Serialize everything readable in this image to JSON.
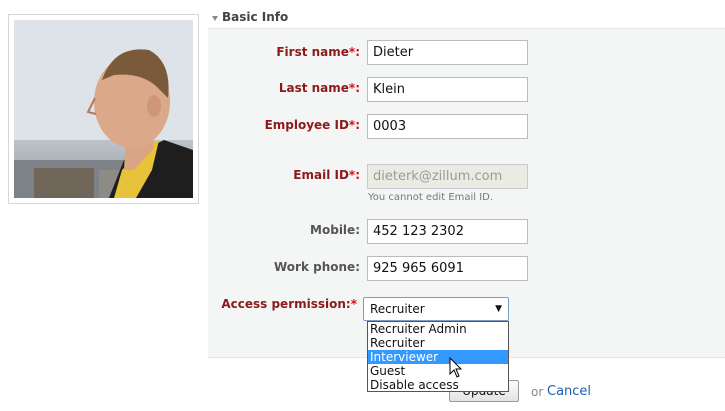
{
  "section": {
    "title": "Basic Info"
  },
  "fields": {
    "first_name": {
      "label": "First name",
      "required_mark": "*:",
      "value": "Dieter"
    },
    "last_name": {
      "label": "Last name",
      "required_mark": "*:",
      "value": "Klein"
    },
    "employee_id": {
      "label": "Employee ID",
      "required_mark": "*:",
      "value": "0003"
    },
    "email": {
      "label": "Email ID",
      "required_mark": "*:",
      "value": "dieterk@zillum.com",
      "hint": "You cannot edit Email ID."
    },
    "mobile": {
      "label": "Mobile:",
      "value": "452 123 2302"
    },
    "work_phone": {
      "label": "Work phone:",
      "value": "925 965 6091"
    },
    "access_permission": {
      "label": "Access permission:",
      "required_mark": "*",
      "selected": "Recruiter",
      "options": [
        "Recruiter Admin",
        "Recruiter",
        "Interviewer",
        "Guest",
        "Disable access"
      ],
      "highlighted_index": 2
    }
  },
  "actions": {
    "update_label": "Update",
    "or_text": "or",
    "cancel_label": "Cancel"
  },
  "colors": {
    "required_label": "#8b1a1a",
    "star": "#d01010",
    "link": "#1a5fb4",
    "highlight": "#3399ff"
  }
}
